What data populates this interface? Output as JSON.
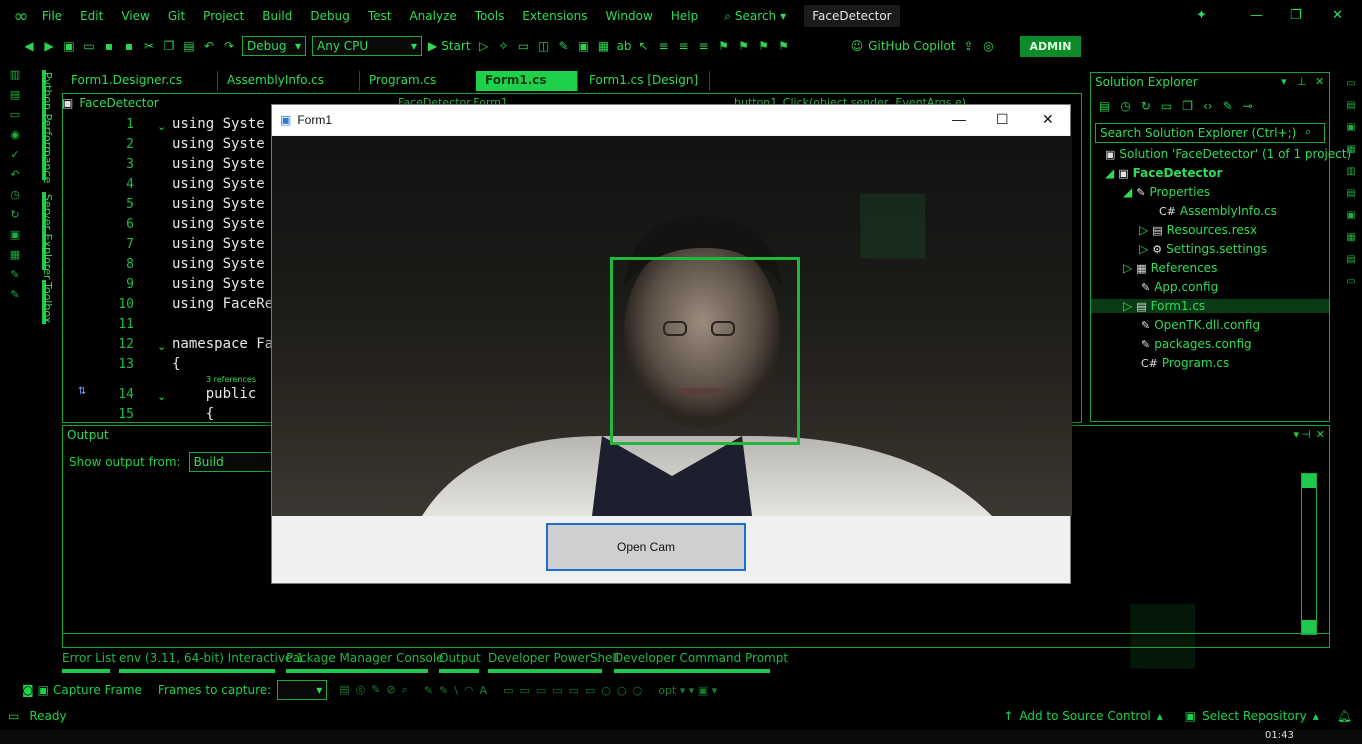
{
  "menubar": {
    "items": [
      "File",
      "Edit",
      "View",
      "Git",
      "Project",
      "Build",
      "Debug",
      "Test",
      "Analyze",
      "Tools",
      "Extensions",
      "Window",
      "Help"
    ],
    "search": "Search",
    "solution_title": "FaceDetector"
  },
  "toolbar": {
    "config": "Debug",
    "platform": "Any CPU",
    "start": "Start",
    "copilot": "GitHub Copilot",
    "admin": "ADMIN"
  },
  "left_panels": [
    "Python Performance",
    "Server Explorer",
    "Toolbox"
  ],
  "tabs": [
    "Form1.Designer.cs",
    "AssemblyInfo.cs",
    "Program.cs",
    "Form1.cs",
    "Form1.cs [Design]"
  ],
  "editor": {
    "nav_project": "FaceDetector",
    "nav_class": "FaceDetector.Form1",
    "nav_member": "button1_Click(object sender, EventArgs e)",
    "lines": [
      {
        "n": "1",
        "code": "using Syste"
      },
      {
        "n": "2",
        "code": "using Syste"
      },
      {
        "n": "3",
        "code": "using Syste"
      },
      {
        "n": "4",
        "code": "using Syste"
      },
      {
        "n": "5",
        "code": "using Syste"
      },
      {
        "n": "6",
        "code": "using Syste"
      },
      {
        "n": "7",
        "code": "using Syste"
      },
      {
        "n": "8",
        "code": "using Syste"
      },
      {
        "n": "9",
        "code": "using Syste"
      },
      {
        "n": "10",
        "code": "using FaceRe"
      },
      {
        "n": "11",
        "code": ""
      },
      {
        "n": "12",
        "code": "namespace Fa"
      },
      {
        "n": "13",
        "code": "{"
      },
      {
        "n": "14",
        "code": "    public "
      },
      {
        "n": "15",
        "code": "    {"
      }
    ],
    "references": "3 references"
  },
  "form": {
    "title": "Form1",
    "open_button": "Open Cam"
  },
  "output": {
    "title": "Output",
    "show_from_label": "Show output from:",
    "show_from_value": "Build"
  },
  "bottom_tabs": [
    "Error List",
    "env (3.11, 64-bit) Interactive 1",
    "Package Manager Console",
    "Output",
    "Developer PowerShell",
    "Developer Command Prompt"
  ],
  "capture": {
    "capture_frame": "Capture Frame",
    "frames_label": "Frames to capture:"
  },
  "status": {
    "ready": "Ready",
    "source_control": "Add to Source Control",
    "repository": "Select Repository",
    "clock": "01:43"
  },
  "solution_explorer": {
    "title": "Solution Explorer",
    "search_placeholder": "Search Solution Explorer (Ctrl+;)",
    "items": [
      {
        "label": "Solution 'FaceDetector' (1 of 1 project)",
        "icon": "solution-icon"
      },
      {
        "label": "FaceDetector",
        "icon": "csharp-project-icon"
      },
      {
        "label": "Properties",
        "icon": "wrench-icon"
      },
      {
        "label": "AssemblyInfo.cs",
        "icon": "csharp-file-icon"
      },
      {
        "label": "Resources.resx",
        "icon": "resx-icon"
      },
      {
        "label": "Settings.settings",
        "icon": "settings-icon"
      },
      {
        "label": "References",
        "icon": "references-icon"
      },
      {
        "label": "App.config",
        "icon": "config-icon"
      },
      {
        "label": "Form1.cs",
        "icon": "form-icon"
      },
      {
        "label": "OpenTK.dll.config",
        "icon": "config-icon"
      },
      {
        "label": "packages.config",
        "icon": "config-icon"
      },
      {
        "label": "Program.cs",
        "icon": "csharp-file-icon"
      }
    ]
  },
  "colors": {
    "accent": "#1fd14a",
    "face_box": "#1fb83c",
    "button_border": "#1a6fd1"
  }
}
